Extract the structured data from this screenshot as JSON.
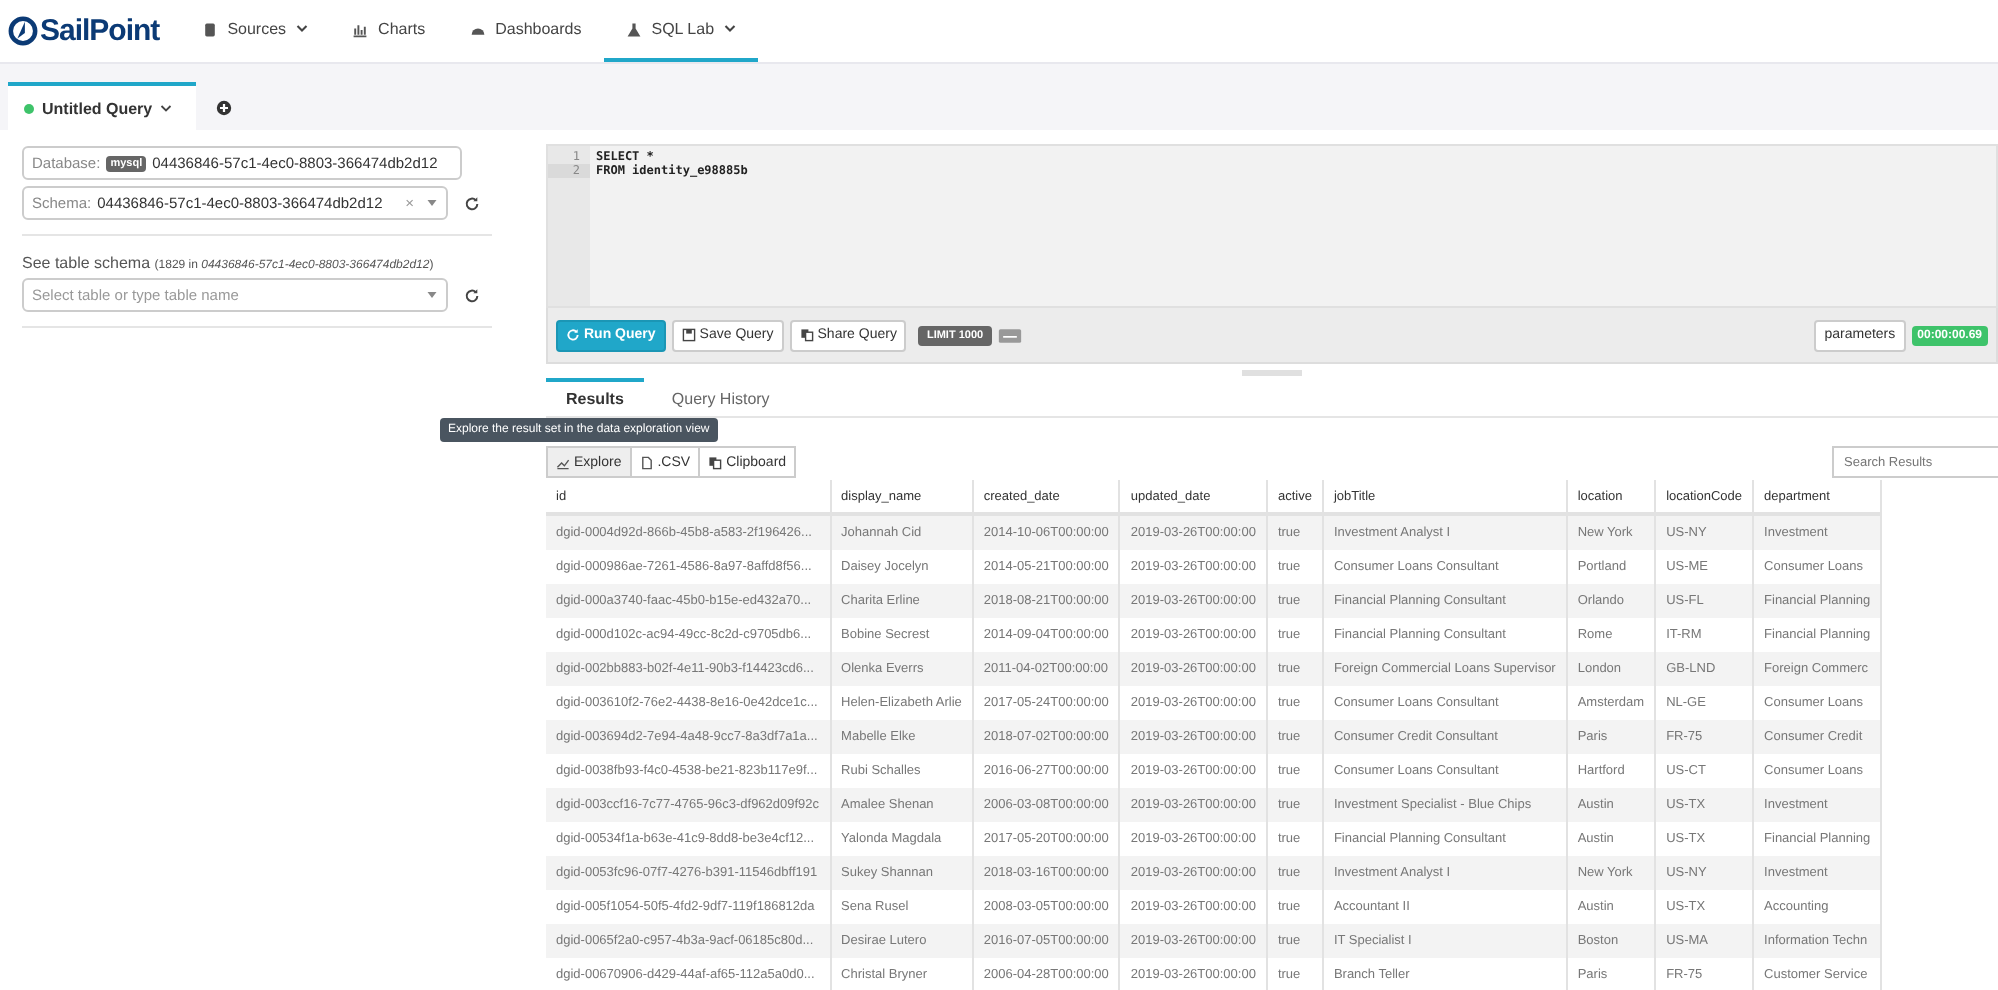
{
  "navbar": {
    "logo": "SailPoint",
    "items": [
      {
        "label": "Sources",
        "selected": false,
        "has_caret": true
      },
      {
        "label": "Charts",
        "selected": false,
        "has_caret": false
      },
      {
        "label": "Dashboards",
        "selected": false,
        "has_caret": false
      },
      {
        "label": "SQL Lab",
        "selected": true,
        "has_caret": true
      }
    ]
  },
  "query_tabs": [
    {
      "label": "Untitled Query",
      "selected": true
    }
  ],
  "left_panel": {
    "database_label": "Database:",
    "database_badge": "mysql",
    "database_value": "04436846-57c1-4ec0-8803-366474db2d12",
    "schema_label": "Schema:",
    "schema_value": "04436846-57c1-4ec0-8803-366474db2d12",
    "clear": "×",
    "table_schema_label": "See table schema",
    "table_count": "(1829 in ",
    "table_schema_name": "04436846-57c1-4ec0-8803-366474db2d12",
    "table_count_end": ")",
    "table_placeholder": "Select table or type table name"
  },
  "editor": {
    "lines": [
      {
        "number": "1",
        "code": "SELECT *"
      },
      {
        "number": "2",
        "code": "FROM identity_e98885b"
      }
    ]
  },
  "toolbar": {
    "run": "Run Query",
    "save": "Save Query",
    "share": "Share Query",
    "limit": "LIMIT 1000",
    "parameters": "parameters",
    "timer": "00:00:00.69"
  },
  "result_tabs": [
    {
      "label": "Results",
      "selected": true
    },
    {
      "label": "Query History",
      "selected": false
    }
  ],
  "tooltip": "Explore the result set in the data exploration view",
  "actions": [
    "Explore",
    ".CSV",
    "Clipboard"
  ],
  "search": {
    "placeholder": "Search Results"
  },
  "table": {
    "columns": [
      "id",
      "display_name",
      "created_date",
      "updated_date",
      "active",
      "jobTitle",
      "location",
      "locationCode",
      "department"
    ],
    "rows": [
      [
        "dgid-0004d92d-866b-45b8-a583-2f196426...",
        "Johannah Cid",
        "2014-10-06T00:00:00",
        "2019-03-26T00:00:00",
        "true",
        "Investment Analyst I",
        "New York",
        "US-NY",
        "Investment"
      ],
      [
        "dgid-000986ae-7261-4586-8a97-8affd8f56...",
        "Daisey Jocelyn",
        "2014-05-21T00:00:00",
        "2019-03-26T00:00:00",
        "true",
        "Consumer Loans Consultant",
        "Portland",
        "US-ME",
        "Consumer Loans"
      ],
      [
        "dgid-000a3740-faac-45b0-b15e-ed432a70...",
        "Charita Erline",
        "2018-08-21T00:00:00",
        "2019-03-26T00:00:00",
        "true",
        "Financial Planning Consultant",
        "Orlando",
        "US-FL",
        "Financial Planning"
      ],
      [
        "dgid-000d102c-ac94-49cc-8c2d-c9705db6...",
        "Bobine Secrest",
        "2014-09-04T00:00:00",
        "2019-03-26T00:00:00",
        "true",
        "Financial Planning Consultant",
        "Rome",
        "IT-RM",
        "Financial Planning"
      ],
      [
        "dgid-002bb883-b02f-4e11-90b3-f14423cd6...",
        "Olenka Everrs",
        "2011-04-02T00:00:00",
        "2019-03-26T00:00:00",
        "true",
        "Foreign Commercial Loans Supervisor",
        "London",
        "GB-LND",
        "Foreign Commerc"
      ],
      [
        "dgid-003610f2-76e2-4438-8e16-0e42dce1c...",
        "Helen-Elizabeth Arlie",
        "2017-05-24T00:00:00",
        "2019-03-26T00:00:00",
        "true",
        "Consumer Loans Consultant",
        "Amsterdam",
        "NL-GE",
        "Consumer Loans"
      ],
      [
        "dgid-003694d2-7e94-4a48-9cc7-8a3df7a1a...",
        "Mabelle Elke",
        "2018-07-02T00:00:00",
        "2019-03-26T00:00:00",
        "true",
        "Consumer Credit Consultant",
        "Paris",
        "FR-75",
        "Consumer Credit"
      ],
      [
        "dgid-0038fb93-f4c0-4538-be21-823b117e9f...",
        "Rubi Schalles",
        "2016-06-27T00:00:00",
        "2019-03-26T00:00:00",
        "true",
        "Consumer Loans Consultant",
        "Hartford",
        "US-CT",
        "Consumer Loans"
      ],
      [
        "dgid-003ccf16-7c77-4765-96c3-df962d09f92c",
        "Amalee Shenan",
        "2006-03-08T00:00:00",
        "2019-03-26T00:00:00",
        "true",
        "Investment Specialist - Blue Chips",
        "Austin",
        "US-TX",
        "Investment"
      ],
      [
        "dgid-00534f1a-b63e-41c9-8dd8-be3e4cf12...",
        "Yalonda Magdala",
        "2017-05-20T00:00:00",
        "2019-03-26T00:00:00",
        "true",
        "Financial Planning Consultant",
        "Austin",
        "US-TX",
        "Financial Planning"
      ],
      [
        "dgid-0053fc96-07f7-4276-b391-11546dbff191",
        "Sukey Shannan",
        "2018-03-16T00:00:00",
        "2019-03-26T00:00:00",
        "true",
        "Investment Analyst I",
        "New York",
        "US-NY",
        "Investment"
      ],
      [
        "dgid-005f1054-50f5-4fd2-9df7-119f186812da",
        "Sena Rusel",
        "2008-03-05T00:00:00",
        "2019-03-26T00:00:00",
        "true",
        "Accountant II",
        "Austin",
        "US-TX",
        "Accounting"
      ],
      [
        "dgid-0065f2a0-c957-4b3a-9acf-06185c80d...",
        "Desirae Lutero",
        "2016-07-05T00:00:00",
        "2019-03-26T00:00:00",
        "true",
        "IT Specialist I",
        "Boston",
        "US-MA",
        "Information Techn"
      ],
      [
        "dgid-00670906-d429-44af-af65-112a5a0d0...",
        "Christal Bryner",
        "2006-04-28T00:00:00",
        "2019-03-26T00:00:00",
        "true",
        "Branch Teller",
        "Paris",
        "FR-75",
        "Customer Service"
      ]
    ]
  }
}
